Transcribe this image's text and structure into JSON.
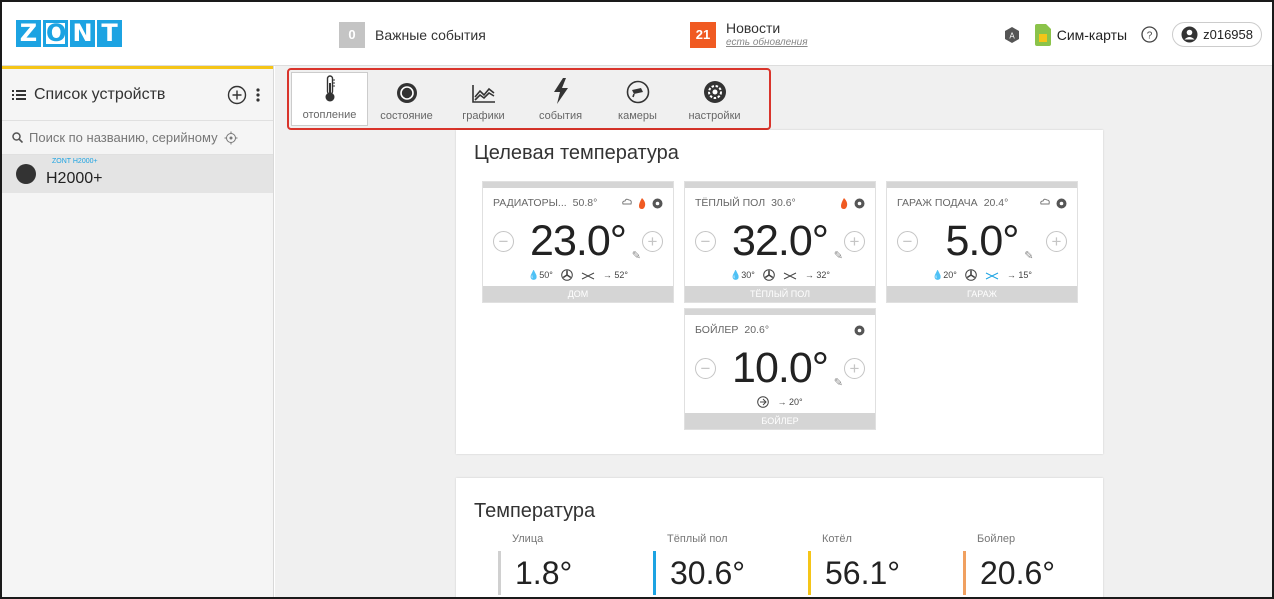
{
  "header": {
    "logo_letters": [
      "Z",
      "O",
      "N",
      "T"
    ],
    "important_events": {
      "count": "0",
      "label": "Важные события"
    },
    "news": {
      "count": "21",
      "label": "Новости",
      "sub": "есть обновления"
    },
    "sim_label": "Сим-карты",
    "user": "z016958",
    "colors": {
      "brand": "#1ca3e2",
      "news": "#f05a22",
      "important": "#c4c4c4",
      "sim": "#8bc34a"
    }
  },
  "sidebar": {
    "title": "Список устройств",
    "search_placeholder": "Поиск по названию, серийному",
    "devices": [
      {
        "model": "ZONT H2000+",
        "name": "H2000+"
      }
    ]
  },
  "tabs": [
    {
      "label": "отопление",
      "icon": "thermometer-icon",
      "active": true
    },
    {
      "label": "состояние",
      "icon": "status-circle-icon",
      "active": false
    },
    {
      "label": "графики",
      "icon": "chart-icon",
      "active": false
    },
    {
      "label": "события",
      "icon": "lightning-icon",
      "active": false
    },
    {
      "label": "камеры",
      "icon": "camera-icon",
      "active": false
    },
    {
      "label": "настройки",
      "icon": "gear-icon",
      "active": false
    }
  ],
  "target": {
    "title": "Целевая температура",
    "zones": [
      {
        "name": "РАДИАТОРЫ...",
        "current": "50.8°",
        "value": "23.0°",
        "flame": true,
        "rain": true,
        "info": [
          "50°",
          "→ 52°"
        ],
        "footer": "ДОМ"
      },
      {
        "name": "ТЁПЛЫЙ ПОЛ",
        "current": "30.6°",
        "value": "32.0°",
        "flame": true,
        "rain": false,
        "info": [
          "30°",
          "→ 32°"
        ],
        "footer": "ТЁПЛЫЙ ПОЛ"
      },
      {
        "name": "ГАРАЖ ПОДАЧА",
        "current": "20.4°",
        "value": "5.0°",
        "flame": false,
        "rain": true,
        "info": [
          "20°",
          "→ 15°"
        ],
        "footer": "ГАРАЖ"
      },
      {
        "name": "БОЙЛЕР",
        "current": "20.6°",
        "value": "10.0°",
        "flame": false,
        "rain": false,
        "info": [
          "→ 20°"
        ],
        "footer": "БОЙЛЕР"
      }
    ]
  },
  "temperature": {
    "title": "Температура",
    "items": [
      {
        "label": "Улица",
        "value": "1.8°",
        "color": "#d0d0d0"
      },
      {
        "label": "Тёплый пол",
        "value": "30.6°",
        "color": "#1ca3e2"
      },
      {
        "label": "Котёл",
        "value": "56.1°",
        "color": "#f5c518"
      },
      {
        "label": "Бойлер",
        "value": "20.6°",
        "color": "#f0a060"
      }
    ]
  }
}
